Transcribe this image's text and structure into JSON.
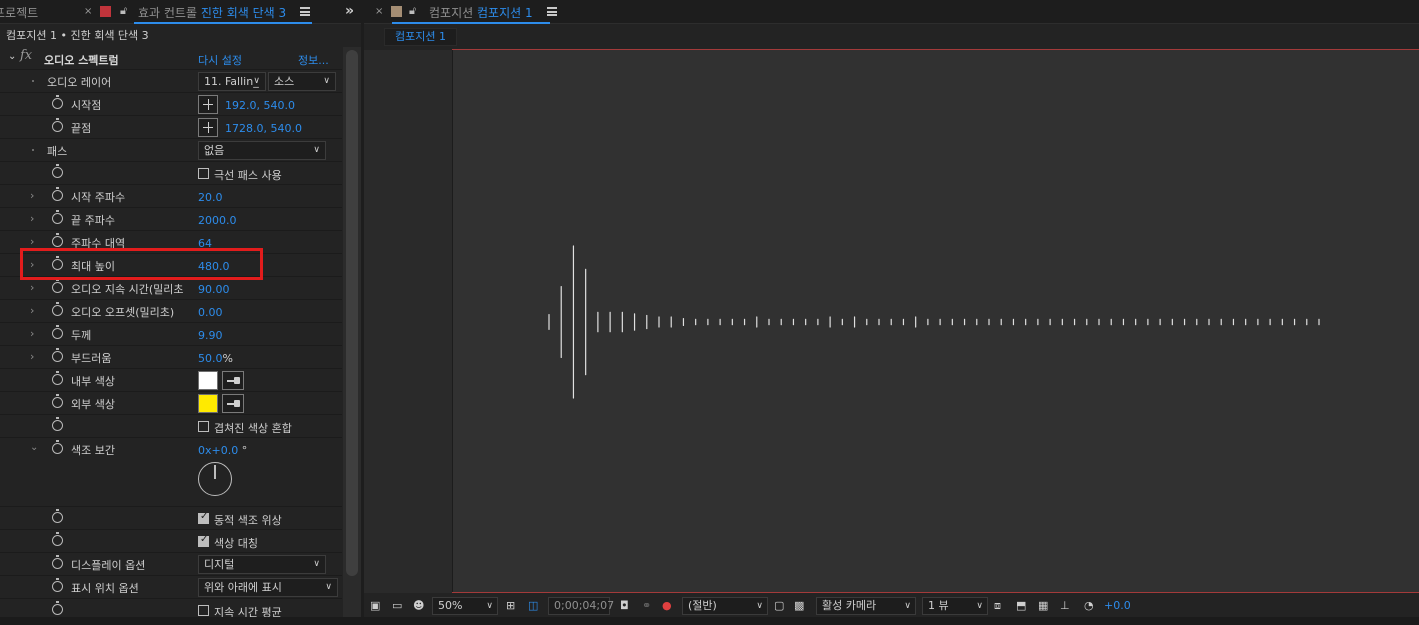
{
  "left_panel": {
    "tab_project": "프로젝트",
    "tab_close": "×",
    "tab_effects_prefix": "효과 컨트롤",
    "tab_effects_layer": "진한 회색 단색 3",
    "lock_icon": "lock-icon",
    "subheader": "컴포지션 1 • 진한 회색 단색 3",
    "expand_glyph": "»"
  },
  "effect": {
    "fx_label": "fx",
    "name": "오디오 스펙트럼",
    "reset": "다시 설정",
    "info": "정보...",
    "rows": {
      "audio_layer": {
        "label": "오디오 레이어",
        "layer_value": "11. Fallin_",
        "source_value": "소스"
      },
      "start_point": {
        "label": "시작점",
        "value": "192.0, 540.0"
      },
      "end_point": {
        "label": "끝점",
        "value": "1728.0, 540.0"
      },
      "path": {
        "label": "패스",
        "value": "없음"
      },
      "polar": {
        "label": "극선 패스 사용",
        "checked": false
      },
      "start_freq": {
        "label": "시작 주파수",
        "value": "20.0"
      },
      "end_freq": {
        "label": "끝 주파수",
        "value": "2000.0"
      },
      "freq_bands": {
        "label": "주파수 대역",
        "value": "64"
      },
      "max_height": {
        "label": "최대 높이",
        "value": "480.0"
      },
      "duration": {
        "label": "오디오 지속 시간(밀리초",
        "value": "90.00"
      },
      "offset": {
        "label": "오디오 오프셋(밀리초)",
        "value": "0.00"
      },
      "thickness": {
        "label": "두께",
        "value": "9.90"
      },
      "softness": {
        "label": "부드러움",
        "value": "50.0",
        "unit": "%"
      },
      "inside_color": {
        "label": "내부 색상",
        "color": "#ffffff"
      },
      "outside_color": {
        "label": "외부 색상",
        "color": "#ffea00"
      },
      "blend": {
        "label": "겹쳐진 색상 혼합",
        "checked": false
      },
      "hue_interp": {
        "label": "색조 보간",
        "value": "0x+0.0",
        "unit": "°"
      },
      "dynamic_hue": {
        "label": "동적 색조 위상",
        "checked": true
      },
      "color_symmetry": {
        "label": "색상 대칭",
        "checked": true
      },
      "display_options": {
        "label": "디스플레이 옵션",
        "value": "디지털"
      },
      "side_options": {
        "label": "표시 위치 옵션",
        "value": "위와 아래에 표시"
      },
      "avg_duration": {
        "label": "지속 시간 평균",
        "checked": false
      }
    }
  },
  "right_panel": {
    "tab_close": "×",
    "tab_prefix": "컴포지션",
    "tab_comp": "컴포지션 1",
    "breadcrumb": "컴포지션 1"
  },
  "toolbar": {
    "zoom": "50%",
    "timecode": "0;00;04;07",
    "resolution": "(절반)",
    "camera": "활성 카메라",
    "views": "1 뷰",
    "exposure": "+0.0"
  },
  "spectrum": {
    "color": "#ffea00",
    "band_magnitudes": [
      0.12,
      0.48,
      1.0,
      0.7,
      0.15,
      0.15,
      0.15,
      0.13,
      0.11,
      0.09,
      0.09,
      0.07,
      0.06,
      0.06,
      0.06,
      0.06,
      0.06,
      0.09,
      0.06,
      0.06,
      0.06,
      0.06,
      0.06,
      0.09,
      0.06,
      0.09,
      0.06,
      0.06,
      0.06,
      0.06,
      0.09,
      0.06,
      0.06,
      0.06,
      0.06,
      0.06,
      0.06,
      0.06,
      0.06,
      0.06,
      0.06,
      0.06,
      0.06,
      0.06,
      0.06,
      0.06,
      0.06,
      0.06,
      0.06,
      0.06,
      0.06,
      0.06,
      0.06,
      0.06,
      0.06,
      0.06,
      0.06,
      0.06,
      0.06,
      0.06,
      0.06,
      0.06,
      0.06,
      0.06
    ]
  }
}
